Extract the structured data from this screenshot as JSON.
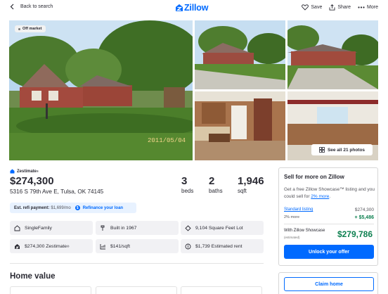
{
  "header": {
    "back_label": "Back to search",
    "logo_text": "Zillow",
    "save_label": "Save",
    "share_label": "Share",
    "more_label": "More"
  },
  "photos": {
    "badge": "Off market",
    "main_date_stamp": "2011/05/04",
    "see_all_label": "See all 21 photos"
  },
  "listing": {
    "zestimate_label": "Zestimate",
    "zestimate_mark": "®",
    "price": "$274,300",
    "address": "5316 S 79th Ave E, Tulsa, OK 74145",
    "beds_value": "3",
    "beds_label": "beds",
    "baths_value": "2",
    "baths_label": "baths",
    "sqft_value": "1,946",
    "sqft_label": "sqft",
    "refi_label": "Est. refi payment:",
    "refi_amount": "$1,699/mo",
    "refi_link": "Refinance your loan"
  },
  "facts": [
    {
      "icon": "house-icon",
      "text": "SingleFamily"
    },
    {
      "icon": "hammer-icon",
      "text": "Built in 1967"
    },
    {
      "icon": "lot-size-icon",
      "text": "9,104 Square Feet Lot"
    },
    {
      "icon": "zestimate-icon",
      "text": "$274,300 Zestimate",
      "mark": "®"
    },
    {
      "icon": "price-per-sqft-icon",
      "text": "$141/sqft"
    },
    {
      "icon": "rent-icon",
      "text": "$1,739 Estimated rent"
    }
  ],
  "home_value_heading": "Home value",
  "sell_card": {
    "title": "Sell for more on Zillow",
    "desc_prefix": "Get a free Zillow Showcase™ listing and you could sell for ",
    "desc_link": "2% more",
    "desc_suffix": ".",
    "standard_label": "Standard listing",
    "standard_value": "$274,300",
    "more_label": "2% more",
    "more_value": "+ $5,486",
    "showcase_label": "With Zillow Showcase",
    "estimated_label": "(estimated)",
    "showcase_value": "$279,786",
    "unlock_label": "Unlock your offer"
  },
  "claim_label": "Claim home",
  "colors": {
    "brand_blue": "#006aff",
    "positive_green": "#0d8050",
    "text": "#2a2a33"
  }
}
